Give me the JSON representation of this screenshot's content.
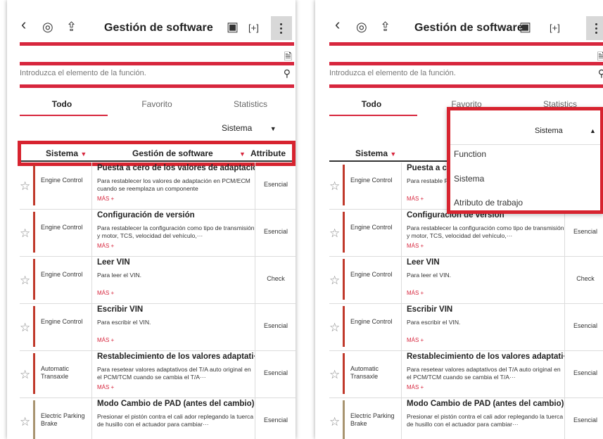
{
  "header": {
    "title": "Gestión de software",
    "back_icon": "‹",
    "menu_icon": "⋮"
  },
  "search": {
    "placeholder": "Introduzca el elemento de la función."
  },
  "tabs": [
    "Todo",
    "Favorito",
    "Statistics"
  ],
  "sort": {
    "selected": "Sistema"
  },
  "table": {
    "headers": [
      "Sistema",
      "Gestión de software",
      "Attribute"
    ]
  },
  "rows": [
    {
      "system": "Engine Control",
      "name": "Puesta a cero de los valores de adaptación",
      "desc": "Para restablecer los valores de adaptación en PCM/ECM cuando se reemplaza un componente",
      "more": "MÁS +",
      "attr": "Esencial"
    },
    {
      "system": "Engine Control",
      "name": "Configuración de versión",
      "desc": "Para restablecer la configuración como tipo de transmisión y motor, TCS, velocidad del vehículo,···",
      "more": "MÁS +",
      "attr": "Esencial"
    },
    {
      "system": "Engine Control",
      "name": "Leer VIN",
      "desc": "Para leer el VIN.",
      "more": "MÁS +",
      "attr": "Check"
    },
    {
      "system": "Engine Control",
      "name": "Escribir VIN",
      "desc": "Para escribir el VIN.",
      "more": "MÁS +",
      "attr": "Esencial"
    },
    {
      "system": "Automatic Transaxle",
      "name": "Restablecimiento de los valores adaptati···",
      "desc": "Para resetear valores adaptativos del T/A auto original en el PCM/TCM cuando se cambia el T/A···",
      "more": "MÁS +",
      "attr": "Esencial"
    },
    {
      "system": "Electric Parking Brake",
      "name": "Modo Cambio de PAD (antes del cambio)",
      "desc": "Presionar el pistón contra el cali ador replegando la tuerca de husillo con el actuador para cambiar···",
      "more": "",
      "attr": "Esencial"
    }
  ],
  "right_panel": {
    "row1_name_short": "Puesta a ce",
    "row1_desc_short": "Para restable PCM/ECM cu",
    "dropdown": {
      "selected": "Sistema",
      "options": [
        "Function",
        "Sistema",
        "Atributo de trabajo"
      ]
    }
  },
  "colors": {
    "accent": "#d7263d",
    "highlight": "#d7232f",
    "bar_red": "#c0392b",
    "bar_tan": "#a89470"
  }
}
